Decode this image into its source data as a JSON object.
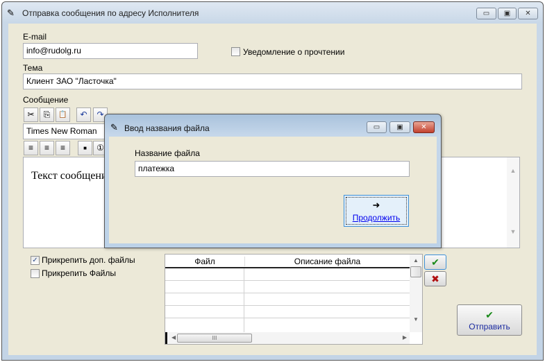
{
  "window": {
    "title": "Отправка сообщения по адресу Исполнителя",
    "min": "▭",
    "restore": "▣",
    "close": "✕"
  },
  "form": {
    "email_label": "E-mail",
    "email_value": "info@rudolg.ru",
    "read_receipt_label": "Уведомление о прочтении",
    "read_receipt_checked": false,
    "subject_label": "Тема",
    "subject_value": "Клиент ЗАО \"Ласточка\"",
    "message_label": "Сообщение",
    "font_value": "Times New Roman",
    "message_text": "Текст сообщения",
    "toolbar": {
      "cut": "✂",
      "copy": "⎘",
      "paste": "📋",
      "undo": "↶",
      "redo": "↷",
      "align_left": "≡",
      "align_center": "≡",
      "align_right": "≡",
      "bullets": "■",
      "numbering": "①"
    }
  },
  "attach": {
    "extra_files_label": "Прикрепить доп. файлы",
    "extra_files_checked": true,
    "files_label": "Прикрепить Файлы",
    "files_checked": false,
    "columns": [
      "Файл",
      "Описание файла"
    ],
    "scroll_thumb": "III"
  },
  "buttons": {
    "ok": "✔",
    "cancel": "✖",
    "send_icon": "✔",
    "send": "Отправить"
  },
  "dialog": {
    "title": "Ввод названия файла",
    "field_label": "Название файла",
    "field_value": "платежка",
    "continue_icon": "➜",
    "continue": "Продолжить"
  },
  "colors": {
    "body": "#ece9d8",
    "link": "#0000ee",
    "green": "#1a8a1a",
    "red": "#b01010"
  }
}
